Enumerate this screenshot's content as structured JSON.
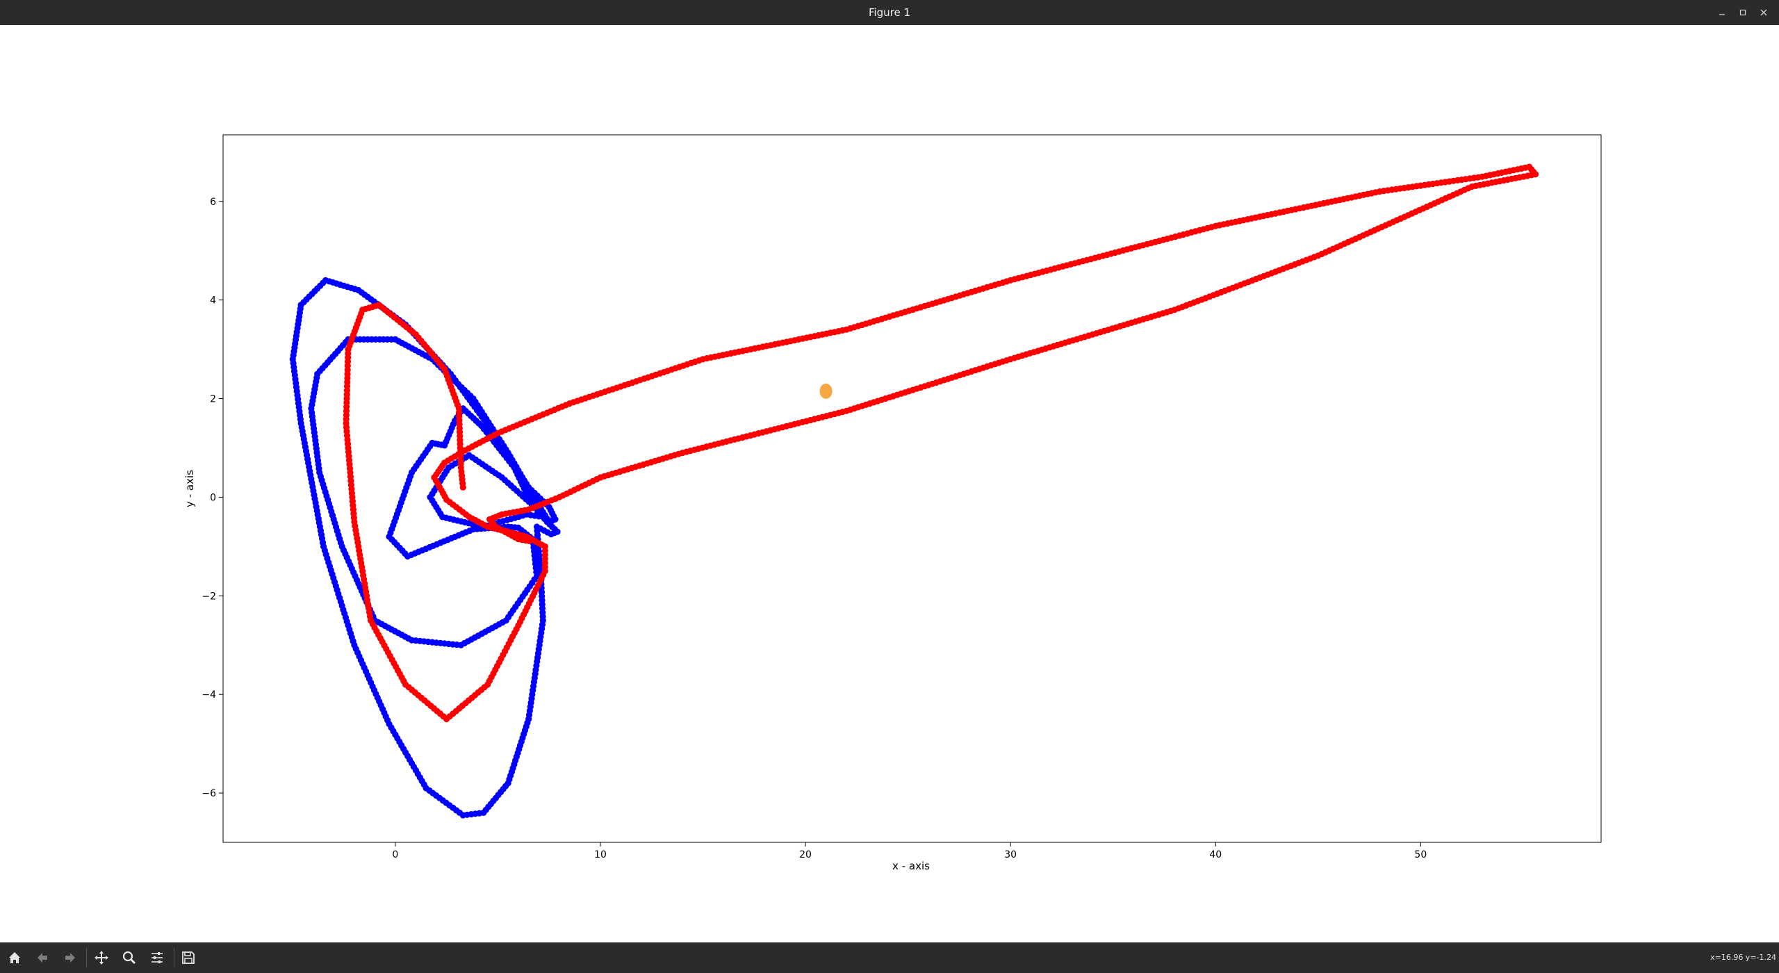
{
  "window": {
    "title": "Figure 1"
  },
  "toolbar": {
    "buttons": [
      {
        "name": "home-icon"
      },
      {
        "name": "back-icon"
      },
      {
        "name": "forward-icon"
      },
      {
        "name": "pan-icon"
      },
      {
        "name": "zoom-icon"
      },
      {
        "name": "configure-subplots-icon"
      },
      {
        "name": "save-icon"
      }
    ],
    "coords": "x=16.96 y=-1.24"
  },
  "chart_data": {
    "type": "scatter",
    "title": "",
    "xlabel": "x - axis",
    "ylabel": "y - axis",
    "xlim": [
      -8.4,
      58.8
    ],
    "ylim": [
      -7.0,
      7.35
    ],
    "xticks": [
      0,
      10,
      20,
      30,
      40,
      50
    ],
    "yticks": [
      -6,
      -4,
      -2,
      0,
      2,
      4,
      6
    ],
    "grid": false,
    "legend": "none",
    "colors": {
      "blue_series": "#0000ff",
      "red_series": "#ff0000",
      "orange_point": "#f4a742"
    },
    "series": [
      {
        "color": "#0000ff",
        "points": [
          [
            3.3,
            -6.45
          ],
          [
            1.5,
            -5.9
          ],
          [
            -0.3,
            -4.6
          ],
          [
            -2.0,
            -3.0
          ],
          [
            -3.5,
            -1.0
          ],
          [
            -4.6,
            1.5
          ],
          [
            -5.0,
            2.8
          ],
          [
            -4.6,
            3.9
          ],
          [
            -3.4,
            4.4
          ],
          [
            -1.8,
            4.2
          ],
          [
            0.5,
            3.5
          ],
          [
            2.7,
            2.5
          ],
          [
            4.8,
            1.3
          ],
          [
            6.5,
            0.2
          ],
          [
            7.5,
            -0.2
          ],
          [
            7.8,
            -0.45
          ],
          [
            7.5,
            -0.5
          ],
          [
            6.9,
            -0.1
          ],
          [
            5.5,
            0.9
          ],
          [
            3.8,
            2.0
          ],
          [
            1.8,
            2.8
          ],
          [
            0.0,
            3.2
          ],
          [
            -2.3,
            3.2
          ],
          [
            -3.8,
            2.5
          ],
          [
            -4.1,
            1.8
          ],
          [
            -3.7,
            0.5
          ],
          [
            -2.6,
            -1.0
          ],
          [
            -1.0,
            -2.5
          ],
          [
            0.8,
            -2.9
          ],
          [
            3.2,
            -3.0
          ],
          [
            5.4,
            -2.5
          ],
          [
            6.9,
            -1.6
          ],
          [
            6.7,
            -0.85
          ],
          [
            6.0,
            -0.62
          ],
          [
            5.5,
            -0.6
          ],
          [
            3.8,
            -0.65
          ],
          [
            0.6,
            -1.2
          ],
          [
            -0.3,
            -0.8
          ],
          [
            0.8,
            0.5
          ],
          [
            1.8,
            1.1
          ],
          [
            2.4,
            1.05
          ],
          [
            2.9,
            1.55
          ],
          [
            3.3,
            1.8
          ],
          [
            4.2,
            1.45
          ],
          [
            5.8,
            0.6
          ],
          [
            6.6,
            -0.1
          ],
          [
            7.2,
            -0.4
          ],
          [
            6.4,
            -0.35
          ],
          [
            4.3,
            -0.6
          ],
          [
            2.3,
            -0.4
          ],
          [
            1.7,
            0.0
          ],
          [
            2.6,
            0.6
          ],
          [
            3.6,
            0.85
          ],
          [
            5.2,
            0.4
          ],
          [
            6.8,
            -0.2
          ],
          [
            7.4,
            -0.5
          ],
          [
            7.9,
            -0.7
          ],
          [
            7.6,
            -0.75
          ],
          [
            6.9,
            -0.6
          ],
          [
            7.1,
            -1.6
          ],
          [
            7.2,
            -2.5
          ],
          [
            6.5,
            -4.5
          ],
          [
            5.5,
            -5.8
          ],
          [
            4.3,
            -6.4
          ],
          [
            3.3,
            -6.45
          ]
        ]
      },
      {
        "color": "#ff0000",
        "points": [
          [
            3.3,
            0.2
          ],
          [
            3.2,
            0.6
          ],
          [
            3.1,
            1.8
          ],
          [
            2.4,
            2.6
          ],
          [
            1.0,
            3.3
          ],
          [
            -0.8,
            3.9
          ],
          [
            -1.6,
            3.8
          ],
          [
            -2.3,
            3.0
          ],
          [
            -2.4,
            1.5
          ],
          [
            -2.0,
            -0.5
          ],
          [
            -1.2,
            -2.5
          ],
          [
            0.5,
            -3.8
          ],
          [
            2.5,
            -4.5
          ],
          [
            4.5,
            -3.8
          ],
          [
            6.0,
            -2.6
          ],
          [
            7.3,
            -1.5
          ],
          [
            7.3,
            -1.0
          ],
          [
            6.4,
            -0.8
          ],
          [
            5.5,
            -0.7
          ],
          [
            4.5,
            -0.6
          ],
          [
            3.6,
            -0.4
          ],
          [
            2.5,
            -0.05
          ],
          [
            1.9,
            0.4
          ],
          [
            2.4,
            0.7
          ],
          [
            3.4,
            0.95
          ],
          [
            5.0,
            1.3
          ],
          [
            8.5,
            1.9
          ],
          [
            15.0,
            2.8
          ],
          [
            22.0,
            3.4
          ],
          [
            30.0,
            4.4
          ],
          [
            40.0,
            5.5
          ],
          [
            48.0,
            6.2
          ],
          [
            53.0,
            6.5
          ],
          [
            55.3,
            6.7
          ],
          [
            55.6,
            6.55
          ],
          [
            52.5,
            6.3
          ],
          [
            45.0,
            4.9
          ],
          [
            38.0,
            3.8
          ],
          [
            30.0,
            2.8
          ],
          [
            22.0,
            1.75
          ],
          [
            14.0,
            0.9
          ],
          [
            10.0,
            0.4
          ],
          [
            8.0,
            0.0
          ],
          [
            6.5,
            -0.25
          ],
          [
            5.2,
            -0.35
          ],
          [
            4.6,
            -0.45
          ],
          [
            4.9,
            -0.6
          ],
          [
            6.0,
            -0.85
          ],
          [
            6.7,
            -0.9
          ]
        ]
      },
      {
        "color": "#f4a742",
        "points": [
          [
            21.0,
            2.15
          ]
        ]
      }
    ]
  }
}
